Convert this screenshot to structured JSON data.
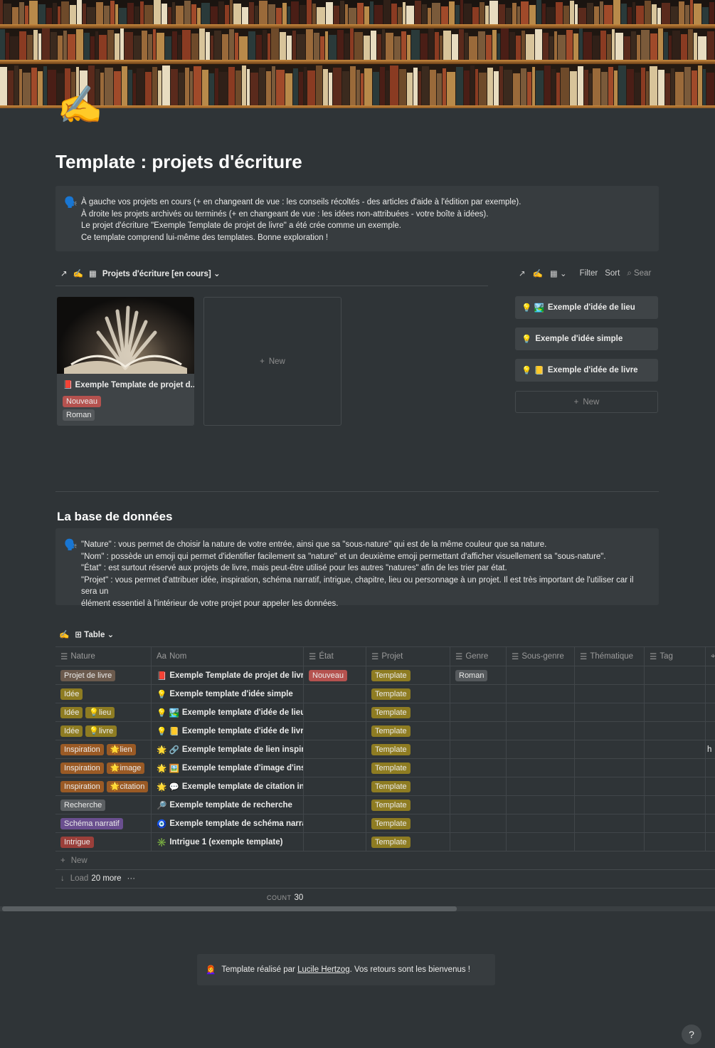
{
  "cover": {
    "label": "bookshelf-cover"
  },
  "page": {
    "icon": "✍️",
    "title": "Template : projets d'écriture"
  },
  "intro_callout": {
    "icon": "🗣️",
    "lines": [
      "À gauche vos projets en cours (+ en changeant de vue : les conseils récoltés - des articles d'aide à l'édition par exemple).",
      "À droite les projets archivés ou terminés (+ en changeant de vue : les idées non-attribuées - votre boîte à idées).",
      "Le projet d'écriture \"Exemple Template de projet de livre\" a été crée comme un exemple.",
      "Ce template comprend lui-même des templates. Bonne exploration !"
    ]
  },
  "left_view": {
    "link_icon": "↗",
    "emoji": "✍️",
    "view_name": "Projets d'écriture [en cours]",
    "card": {
      "icon": "📕",
      "title": "Exemple Template de projet d...",
      "tags": [
        {
          "label": "Nouveau",
          "color": "#b5524f"
        },
        {
          "label": "Roman",
          "color": "#55595c"
        }
      ]
    },
    "new_label": "New"
  },
  "right_view": {
    "link_icon": "↗",
    "emoji": "✍️",
    "filter": "Filter",
    "sort": "Sort",
    "search": "Sear",
    "items": [
      {
        "icons": "💡 🏞️",
        "label": "Exemple d'idée de lieu"
      },
      {
        "icons": "💡",
        "label": "Exemple d'idée simple"
      },
      {
        "icons": "💡 📒",
        "label": "Exemple d'idée de livre"
      }
    ],
    "new_label": "New"
  },
  "database": {
    "title": "La base de données",
    "callout_icon": "🗣️",
    "callout_lines": [
      "\"Nature\" : vous permet de choisir la nature de votre entrée, ainsi que sa \"sous-nature\" qui est de la même couleur que sa nature.",
      "\"Nom\" : possède un emoji qui permet d'identifier facilement sa \"nature\" et un deuxième emoji permettant d'afficher visuellement sa \"sous-nature\".",
      "\"État\" : est surtout réservé aux projets de livre, mais peut-être utilisé pour les autres \"natures\" afin de les trier par état.",
      "\"Projet\" : vous permet d'attribuer idée, inspiration, schéma narratif, intrigue, chapitre, lieu ou personnage à un projet. Il est très important de l'utiliser car il sera un",
      "élément essentiel à l'intérieur de votre projet pour appeler les données."
    ],
    "view_emoji": "✍️",
    "view_name": "Table",
    "columns": [
      "Nature",
      "Nom",
      "État",
      "Projet",
      "Genre",
      "Sous-genre",
      "Thématique",
      "Tag"
    ],
    "rows": [
      {
        "nature": [
          {
            "label": "Projet de livre",
            "color": "#6b5a4d"
          }
        ],
        "icons": "📕",
        "name": "Exemple Template de projet de livre",
        "etat": "Nouveau",
        "projet": "Template",
        "genre": "Roman"
      },
      {
        "nature": [
          {
            "label": "Idée",
            "color": "#8e7c22"
          }
        ],
        "icons": "💡",
        "name": "Exemple template d'idée simple",
        "etat": "",
        "projet": "Template",
        "genre": ""
      },
      {
        "nature": [
          {
            "label": "Idée",
            "color": "#8e7c22"
          },
          {
            "label": "💡lieu",
            "color": "#8e7c22"
          }
        ],
        "icons": "💡 🏞️",
        "name": "Exemple template d'idée de lieu",
        "etat": "",
        "projet": "Template",
        "genre": ""
      },
      {
        "nature": [
          {
            "label": "Idée",
            "color": "#8e7c22"
          },
          {
            "label": "💡livre",
            "color": "#8e7c22"
          }
        ],
        "icons": "💡 📒",
        "name": "Exemple template d'idée de livre",
        "etat": "",
        "projet": "Template",
        "genre": ""
      },
      {
        "nature": [
          {
            "label": "Inspiration",
            "color": "#9a5a25"
          },
          {
            "label": "🌟lien",
            "color": "#9a5a25"
          }
        ],
        "icons": "🌟 🔗",
        "name": "Exemple template de lien inspirant",
        "etat": "",
        "projet": "Template",
        "genre": "",
        "extra": "h"
      },
      {
        "nature": [
          {
            "label": "Inspiration",
            "color": "#9a5a25"
          },
          {
            "label": "🌟image",
            "color": "#9a5a25"
          }
        ],
        "icons": "🌟 🖼️",
        "name": "Exemple template d'image d'inspi",
        "etat": "",
        "projet": "Template",
        "genre": ""
      },
      {
        "nature": [
          {
            "label": "Inspiration",
            "color": "#9a5a25"
          },
          {
            "label": "🌟citation",
            "color": "#9a5a25"
          }
        ],
        "icons": "🌟 💬",
        "name": "Exemple template de citation inspi",
        "etat": "",
        "projet": "Template",
        "genre": ""
      },
      {
        "nature": [
          {
            "label": "Recherche",
            "color": "#5b5f62"
          }
        ],
        "icons": "🔎",
        "name": "Exemple template de recherche",
        "etat": "",
        "projet": "Template",
        "genre": ""
      },
      {
        "nature": [
          {
            "label": "Schéma narratif",
            "color": "#6a4f8f"
          }
        ],
        "icons": "🧿",
        "name": "Exemple template de schéma narratif",
        "etat": "",
        "projet": "Template",
        "genre": ""
      },
      {
        "nature": [
          {
            "label": "Intrigue",
            "color": "#9a3f3a"
          }
        ],
        "icons": "✳️",
        "name": "Intrigue 1 (exemple template)",
        "etat": "",
        "projet": "Template",
        "genre": ""
      }
    ],
    "new_label": "New",
    "load_more_prefix": "Load",
    "load_more_count": "20 more",
    "count_label": "COUNT",
    "count_value": "30"
  },
  "colors": {
    "etat_nouveau": "#b5524f",
    "projet_template": "#8e7c22",
    "genre_roman": "#55595c"
  },
  "footer": {
    "icon": "👩‍🦰",
    "prefix": "Template réalisé par ",
    "author": "Lucile Hertzog",
    "suffix": ". Vos retours sont les bienvenus !"
  },
  "help": {
    "label": "?"
  }
}
